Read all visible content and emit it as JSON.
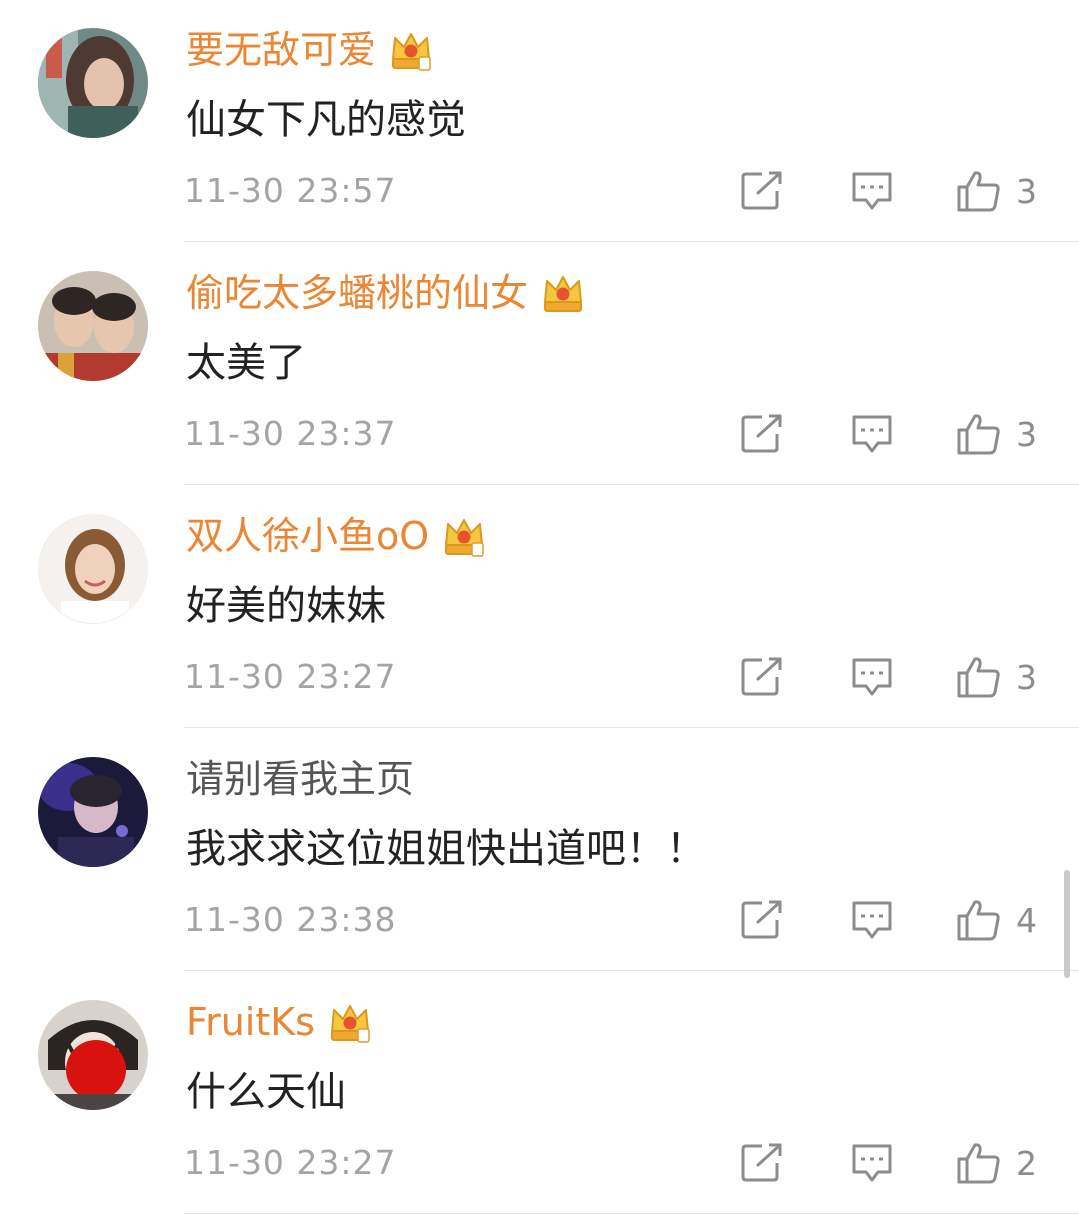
{
  "comments": [
    {
      "username": "要无敌可爱",
      "vip": true,
      "text": "仙女下凡的感觉",
      "time": "11-30 23:57",
      "likes": "3"
    },
    {
      "username": "偷吃太多蟠桃的仙女",
      "vip": true,
      "text": "太美了",
      "time": "11-30 23:37",
      "likes": "3"
    },
    {
      "username": "双人徐小鱼oO",
      "vip": true,
      "text": "好美的妹妹",
      "time": "11-30 23:27",
      "likes": "3"
    },
    {
      "username": "请别看我主页",
      "vip": false,
      "text": "我求求这位姐姐快出道吧！！",
      "time": "11-30 23:38",
      "likes": "4"
    },
    {
      "username": "FruitKs",
      "vip": true,
      "text": "什么天仙",
      "time": "11-30 23:27",
      "likes": "2"
    }
  ],
  "icons": {
    "share": "share-icon",
    "reply": "comment-icon",
    "like": "thumbs-up-icon",
    "badge": "crown-badge-icon"
  },
  "colors": {
    "vip_username": "#ea8634",
    "plain_username": "#555555",
    "comment_text": "#222222",
    "timestamp": "#a4a4a4",
    "icon": "#8c8c8c"
  }
}
